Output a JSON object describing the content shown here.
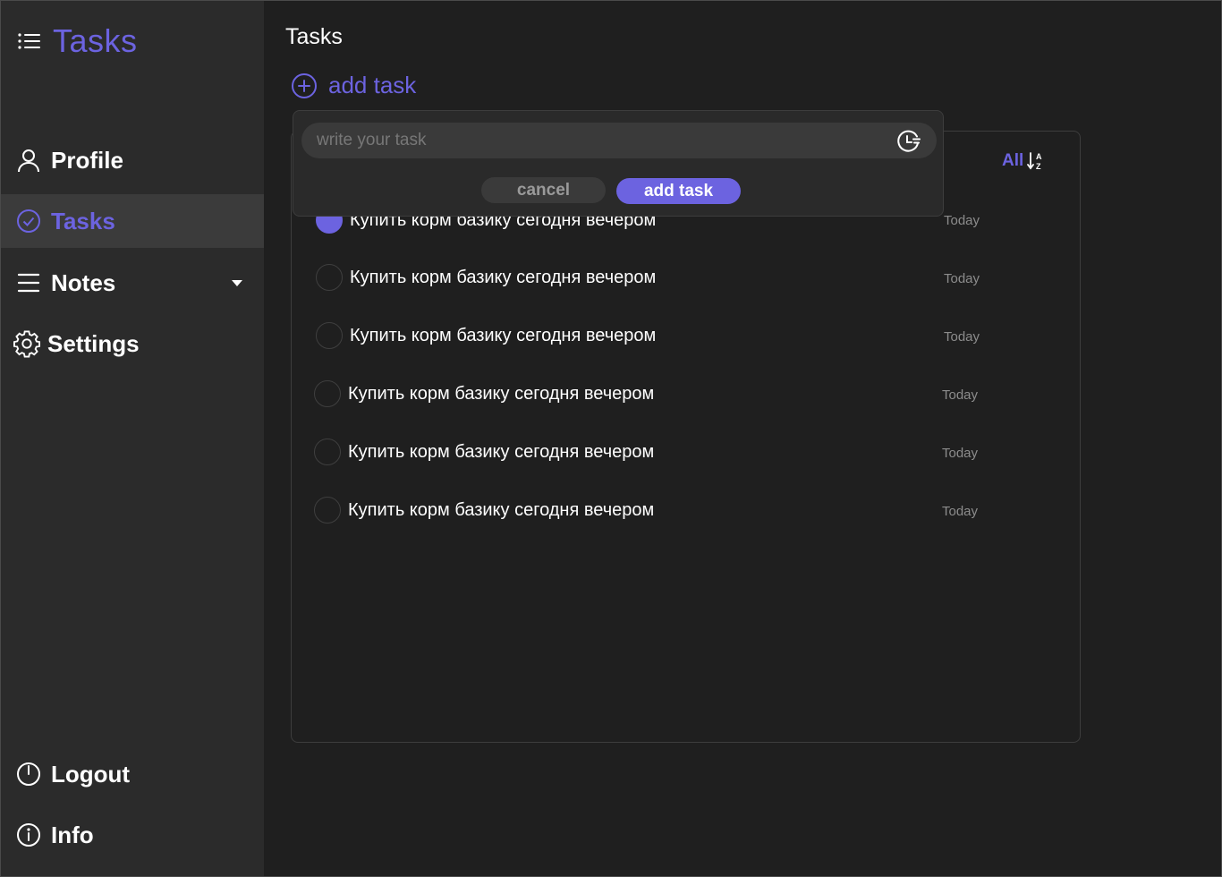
{
  "app": {
    "title": "Tasks",
    "accent_color": "#6c63e0",
    "icon": "list-icon"
  },
  "sidebar": {
    "items": [
      {
        "label": "Profile",
        "icon": "user-icon"
      },
      {
        "label": "Tasks",
        "icon": "check-circle-icon",
        "active": true
      },
      {
        "label": "Notes",
        "icon": "menu-icon",
        "has_dropdown": true
      },
      {
        "label": "Settings",
        "icon": "gear-icon"
      }
    ],
    "bottom_items": [
      {
        "label": "Logout",
        "icon": "power-icon"
      },
      {
        "label": "Info",
        "icon": "info-icon"
      }
    ]
  },
  "main": {
    "page_title": "Tasks",
    "add_task_label": "add task",
    "filter_label": "All",
    "sort_icon": "sort-alpha-icon"
  },
  "tasks": [
    {
      "text": "Купить корм базику сегодня вечером",
      "date": "Today",
      "done": true
    },
    {
      "text": "Купить корм базику сегодня вечером",
      "date": "Today",
      "done": false
    },
    {
      "text": "Купить корм базику сегодня вечером",
      "date": "Today",
      "done": false
    },
    {
      "text": "Купить корм базику сегодня вечером",
      "date": "Today",
      "done": false
    },
    {
      "text": "Купить корм базику сегодня вечером",
      "date": "Today",
      "done": false
    },
    {
      "text": "Купить корм базику сегодня вечером",
      "date": "Today",
      "done": false
    }
  ],
  "popup": {
    "input_value": "",
    "input_placeholder": "write your task",
    "cancel_label": "cancel",
    "submit_label": "add task",
    "schedule_icon": "clock-icon"
  }
}
